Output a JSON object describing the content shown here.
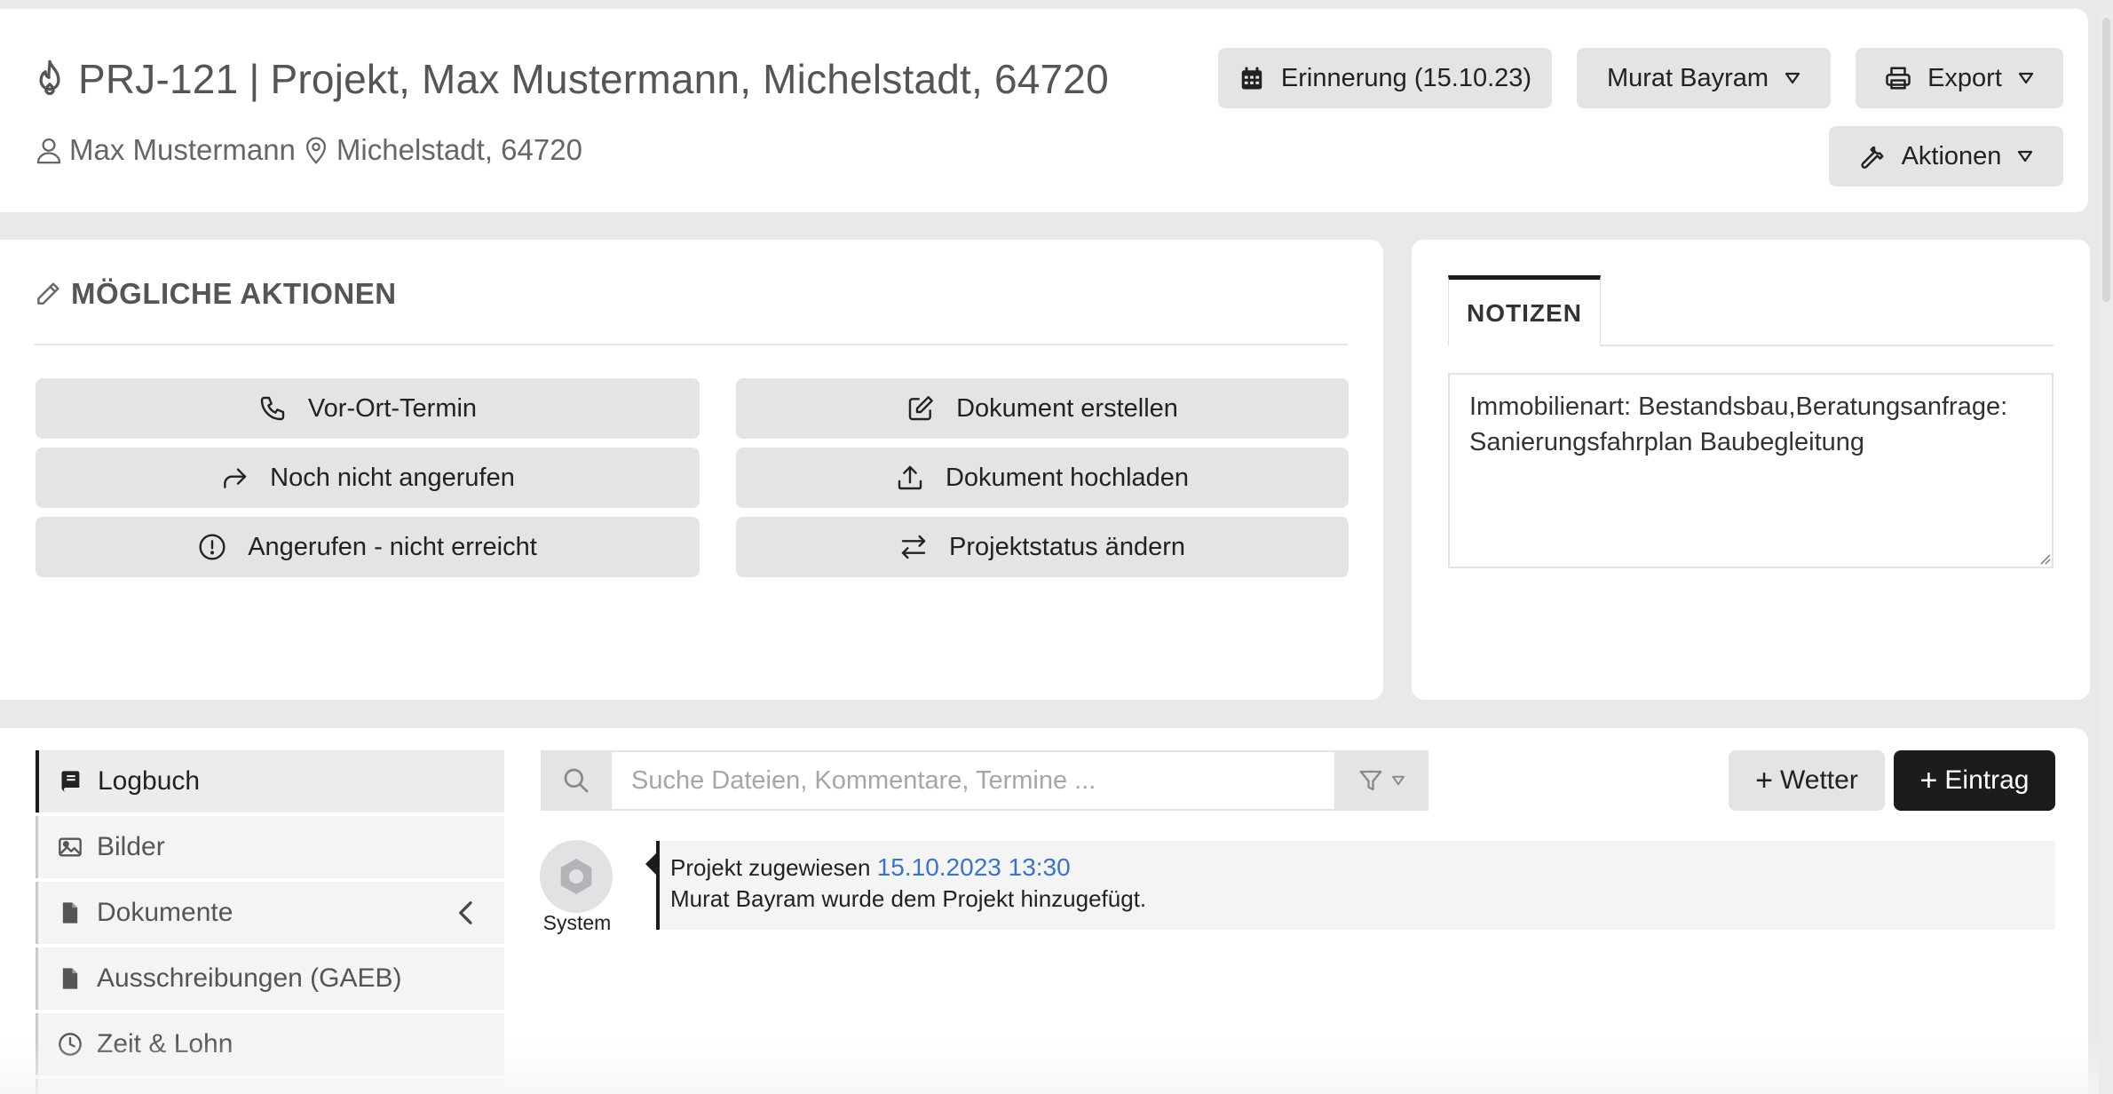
{
  "header": {
    "project_id": "PRJ-121",
    "separator": "|",
    "project_title": "Projekt, Max Mustermann, Michelstadt, 64720",
    "customer_name": "Max Mustermann",
    "location": "Michelstadt, 64720",
    "buttons": {
      "reminder": "Erinnerung (15.10.23)",
      "user": "Murat Bayram",
      "export": "Export",
      "actions": "Aktionen"
    }
  },
  "possible_actions": {
    "title": "MÖGLICHE AKTIONEN",
    "buttons": [
      {
        "label": "Vor-Ort-Termin",
        "icon": "phone-icon"
      },
      {
        "label": "Dokument erstellen",
        "icon": "edit-document-icon"
      },
      {
        "label": "Noch nicht angerufen",
        "icon": "forward-arrow-icon"
      },
      {
        "label": "Dokument hochladen",
        "icon": "upload-icon"
      },
      {
        "label": "Angerufen - nicht erreicht",
        "icon": "alert-circle-icon"
      },
      {
        "label": "Projektstatus ändern",
        "icon": "swap-arrows-icon"
      }
    ]
  },
  "notes": {
    "tab_label": "NOTIZEN",
    "text": "Immobilienart: Bestandsbau,Beratungsanfrage: Sanierungsfahrplan Baubegleitung"
  },
  "sidebar": {
    "items": [
      {
        "label": "Logbuch",
        "icon": "book-icon",
        "active": true
      },
      {
        "label": "Bilder",
        "icon": "image-icon"
      },
      {
        "label": "Dokumente",
        "icon": "file-icon"
      },
      {
        "label": "Ausschreibungen (GAEB)",
        "icon": "file-icon"
      },
      {
        "label": "Zeit & Lohn",
        "icon": "clock-icon"
      }
    ]
  },
  "search": {
    "placeholder": "Suche Dateien, Kommentare, Termine ..."
  },
  "toolbar": {
    "weather_label": "Wetter",
    "entry_label": "Eintrag"
  },
  "log": {
    "entries": [
      {
        "author": "System",
        "title": "Projekt zugewiesen",
        "date": "15.10.2023 13:30",
        "message": "Murat Bayram wurde dem Projekt hinzugefügt."
      }
    ]
  },
  "colors": {
    "accent_dark": "#1c1c1c",
    "link_blue": "#3b73c8",
    "button_grey": "#e4e4e6"
  }
}
